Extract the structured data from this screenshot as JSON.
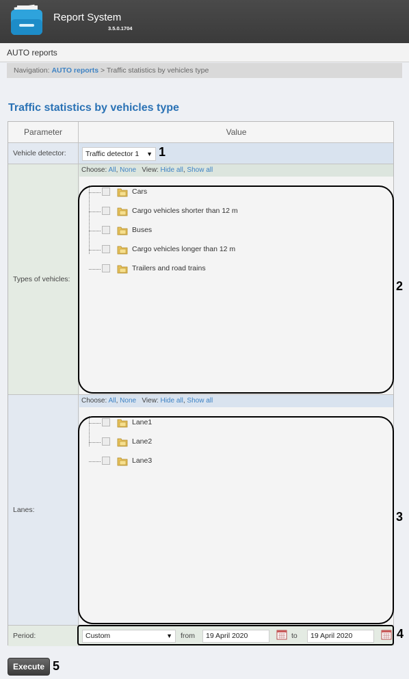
{
  "app": {
    "title": "Report System",
    "version": "3.5.0.1704"
  },
  "section": {
    "title": "AUTO reports"
  },
  "breadcrumb": {
    "prefix": "Navigation:",
    "link": "AUTO reports",
    "separator": ">",
    "current": "Traffic statistics by vehicles type"
  },
  "page": {
    "title": "Traffic statistics by vehicles type"
  },
  "table": {
    "headers": {
      "parameter": "Parameter",
      "value": "Value"
    },
    "detector": {
      "label": "Vehicle detector:",
      "selected": "Traffic detector 1"
    },
    "types": {
      "label": "Types of vehicles:",
      "choose_label": "Choose:",
      "choose_all": "All",
      "choose_none": "None",
      "view_label": "View:",
      "hide_all": "Hide all",
      "show_all": "Show all",
      "items": [
        {
          "label": "Cars"
        },
        {
          "label": "Cargo vehicles shorter than 12 m"
        },
        {
          "label": "Buses"
        },
        {
          "label": "Cargo vehicles longer than 12 m"
        },
        {
          "label": "Trailers and road trains"
        }
      ]
    },
    "lanes": {
      "label": "Lanes:",
      "choose_label": "Choose:",
      "choose_all": "All",
      "choose_none": "None",
      "view_label": "View:",
      "hide_all": "Hide all",
      "show_all": "Show all",
      "items": [
        {
          "label": "Lane1"
        },
        {
          "label": "Lane2"
        },
        {
          "label": "Lane3"
        }
      ]
    },
    "period": {
      "label": "Period:",
      "selected": "Custom",
      "from_label": "from",
      "from_value": "19 April 2020",
      "to_label": "to",
      "to_value": "19 April 2020"
    }
  },
  "execute": {
    "label": "Execute"
  },
  "annotations": {
    "n1": "1",
    "n2": "2",
    "n3": "3",
    "n4": "4",
    "n5": "5"
  },
  "colors": {
    "accent": "#2a72b5",
    "link": "#3f83c4"
  }
}
